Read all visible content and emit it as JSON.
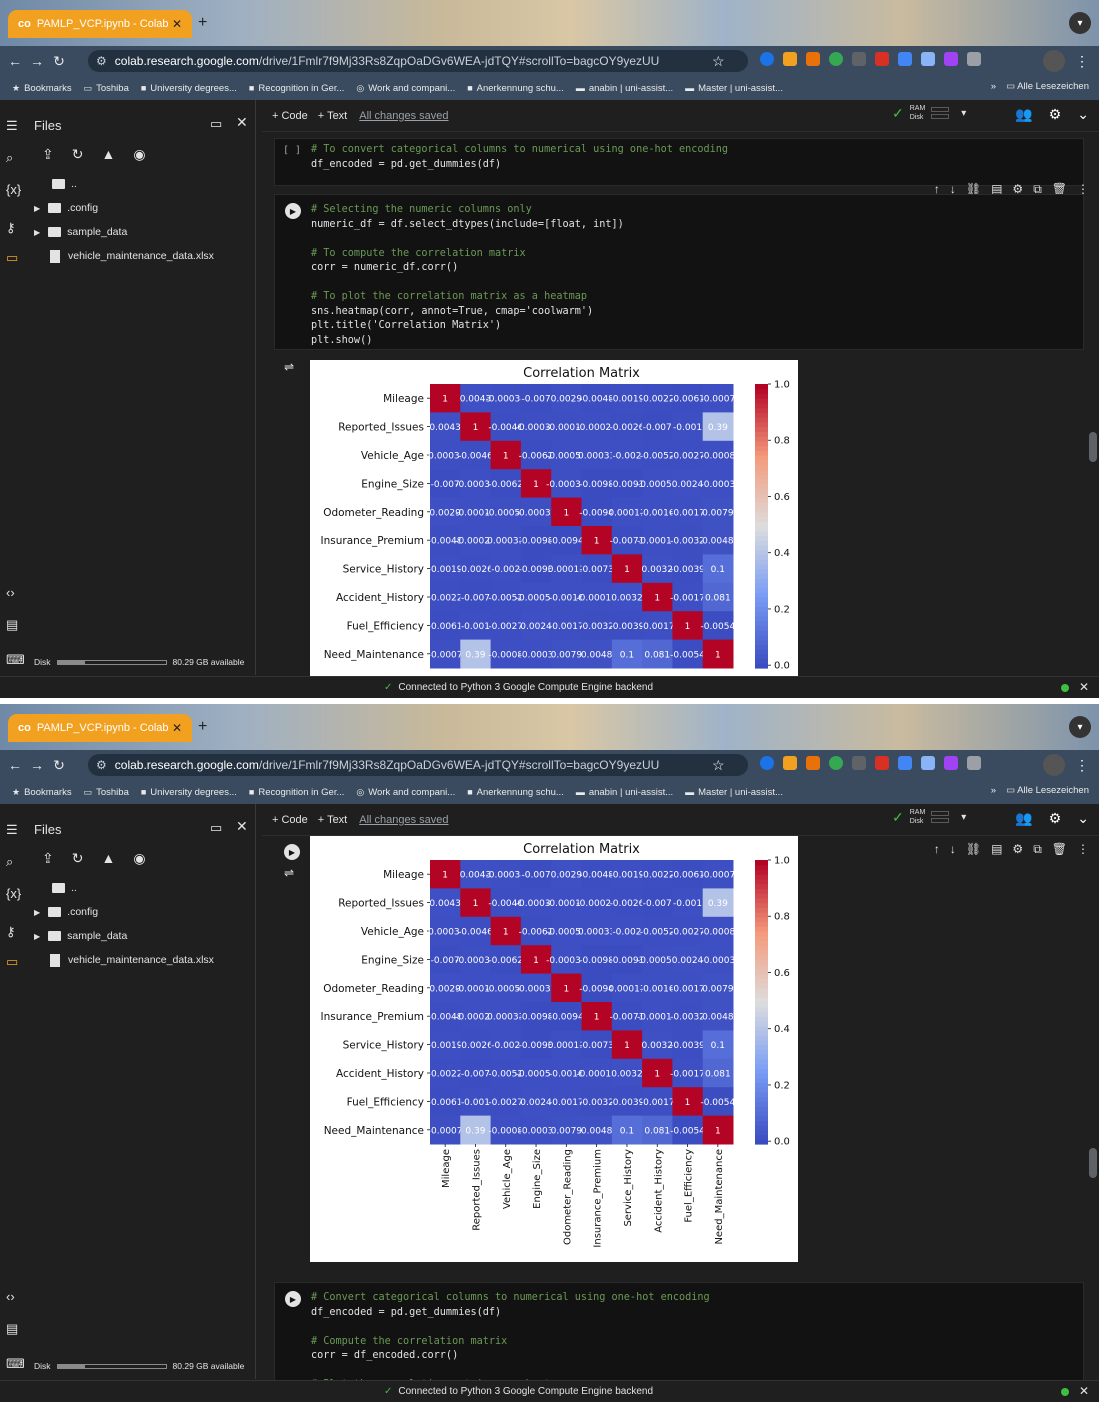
{
  "browser": {
    "tab_title": "PAMLP_VCP.ipynb - Colab",
    "tab_icon": "co",
    "url_site": "colab.research.google.com",
    "url_path": "/drive/1Fmlr7f9Mj33Rs8ZqpOaDGv6WEA-jdTQY#scrollTo=bagcOY9yezUU",
    "bookmarks": [
      {
        "label": "Bookmarks",
        "icon": "star-icon"
      },
      {
        "label": "Toshiba",
        "icon": "folder-icon"
      },
      {
        "label": "University degrees...",
        "icon": "bookmark-favicon"
      },
      {
        "label": "Recognition in Ger...",
        "icon": "bookmark-favicon"
      },
      {
        "label": "Work and compani...",
        "icon": "globe-icon"
      },
      {
        "label": "Anerkennung schu...",
        "icon": "bookmark-favicon"
      },
      {
        "label": "anabin | uni-assist...",
        "icon": "flag-icon"
      },
      {
        "label": "Master | uni-assist...",
        "icon": "flag-icon"
      }
    ],
    "bookmarks_more": "»",
    "all_bookmarks": "Alle Lesezeichen"
  },
  "colab": {
    "add_code": "+ Code",
    "add_text": "+ Text",
    "save_status": "All changes saved",
    "ram_label": "RAM",
    "disk_label": "Disk"
  },
  "files": {
    "title": "Files",
    "parent": "..",
    "items": [
      {
        "name": ".config",
        "type": "folder"
      },
      {
        "name": "sample_data",
        "type": "folder"
      },
      {
        "name": "vehicle_maintenance_data.xlsx",
        "type": "file"
      }
    ],
    "disk_label": "Disk",
    "disk_available": "80.29 GB available",
    "disk_used_fraction": 0.25
  },
  "status": {
    "text": "Connected to Python 3 Google Compute Engine backend"
  },
  "cells": {
    "cell_a": [
      "# To convert categorical columns to numerical using one-hot encoding",
      "df_encoded = pd.get_dummies(df)"
    ],
    "cell_b": [
      "# Selecting the numeric columns only",
      "numeric_df = df.select_dtypes(include=[float, int])",
      "",
      "# To compute the correlation matrix",
      "corr = numeric_df.corr()",
      "",
      "# To plot the correlation matrix as a heatmap",
      "sns.heatmap(corr, annot=True, cmap='coolwarm')",
      "plt.title('Correlation Matrix')",
      "plt.show()"
    ],
    "cell_c": [
      "# Convert categorical columns to numerical using one-hot encoding",
      "df_encoded = pd.get_dummies(df)",
      "",
      "# Compute the correlation matrix",
      "corr = df_encoded.corr()",
      "",
      "# Plot the correlation matrix as a heatmap"
    ],
    "empty_bracket": "[ ]"
  },
  "chart_data": {
    "type": "heatmap",
    "title": "Correlation Matrix",
    "row_labels": [
      "Mileage",
      "Reported_Issues",
      "Vehicle_Age",
      "Engine_Size",
      "Odometer_Reading",
      "Insurance_Premium",
      "Service_History",
      "Accident_History",
      "Fuel_Efficiency",
      "Need_Maintenance"
    ],
    "col_labels": [
      "Mileage",
      "Reported_Issues",
      "Vehicle_Age",
      "Engine_Size",
      "Odometer_Reading",
      "Insurance_Premium",
      "Service_History",
      "Accident_History",
      "Fuel_Efficiency",
      "Need_Maintenance"
    ],
    "cell_text": [
      [
        "1",
        "0.0043",
        "-0.00034",
        "-0.007",
        "0.0029",
        "-0.0048",
        "-0.0019",
        "-0.0022",
        "-0.0061",
        "-0.0007"
      ],
      [
        "0.0043",
        "1",
        "-0.0046",
        "-0.00035",
        "-0.00012",
        "-0.00025",
        "-0.0026",
        "-0.007",
        "-0.001",
        "0.39"
      ],
      [
        "-0.00034",
        "-0.0046",
        "1",
        "-0.0062",
        "-0.00056",
        "0.00033",
        "-0.002",
        "-0.0052",
        "-0.0027",
        "-0.0008"
      ],
      [
        "-0.007",
        "-0.00035",
        "-0.0062",
        "1",
        "-0.00037",
        "-0.0098",
        "-0.0093",
        "-0.00055",
        "0.0024",
        "-0.0003"
      ],
      [
        "0.0029",
        "-0.00012",
        "-0.00056",
        "-0.00037",
        "1",
        "-0.0094",
        "0.00011",
        "-0.0016",
        "-0.0017",
        "0.0079"
      ],
      [
        "-0.0048",
        "-0.00025",
        "0.00033",
        "-0.0098",
        "-0.0094",
        "1",
        "-0.0073",
        "-0.00012",
        "-0.0032",
        "0.0048"
      ],
      [
        "-0.0019",
        "-0.0026",
        "-0.002",
        "-0.0093",
        "0.00011",
        "-0.0073",
        "1",
        "0.0032",
        "-0.0039",
        "0.1"
      ],
      [
        "-0.0022",
        "-0.007",
        "-0.0052",
        "-0.00055",
        "-0.0016",
        "-0.00012",
        "0.0032",
        "1",
        "-0.0017",
        "0.081"
      ],
      [
        "-0.0061",
        "-0.001",
        "-0.0027",
        "0.0024",
        "-0.0017",
        "-0.0032",
        "-0.0039",
        "-0.0017",
        "1",
        "-0.0054"
      ],
      [
        "-0.0007",
        "0.39",
        "-0.0008",
        "-0.0003",
        "0.0079",
        "0.0048",
        "0.1",
        "0.081",
        "-0.0054",
        "1"
      ]
    ],
    "colorbar_ticks": [
      "0.0",
      "0.2",
      "0.4",
      "0.6",
      "0.8",
      "1.0"
    ],
    "vmin": -0.01,
    "vmax": 1.0,
    "cmap": "coolwarm"
  }
}
